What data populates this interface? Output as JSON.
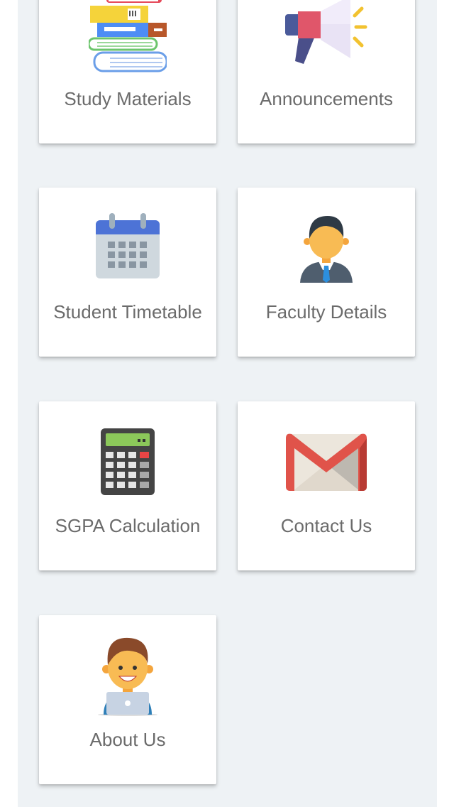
{
  "menu": {
    "items": [
      {
        "label": "Study Materials",
        "icon": "books-icon"
      },
      {
        "label": "Announcements",
        "icon": "megaphone-icon"
      },
      {
        "label": "Student Timetable",
        "icon": "calendar-icon"
      },
      {
        "label": "Faculty Details",
        "icon": "teacher-icon"
      },
      {
        "label": "SGPA Calculation",
        "icon": "calculator-icon"
      },
      {
        "label": "Contact Us",
        "icon": "mail-icon"
      },
      {
        "label": "About Us",
        "icon": "developer-icon"
      }
    ]
  },
  "colors": {
    "background": "#eef2f5",
    "card": "#ffffff",
    "label_text": "#6b6b6b"
  }
}
